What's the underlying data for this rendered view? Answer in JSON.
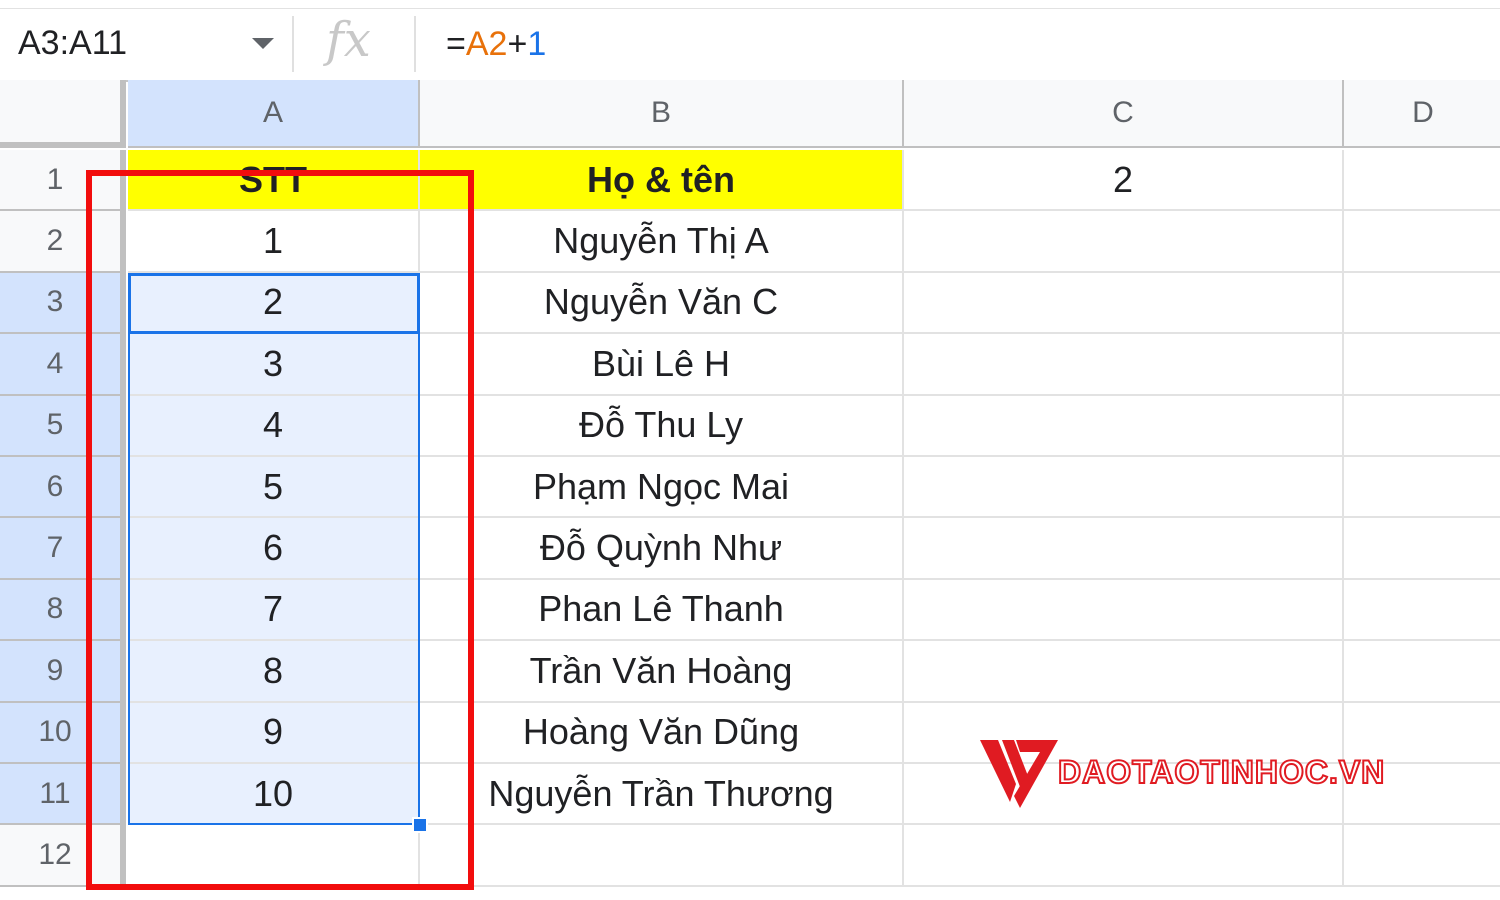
{
  "formula_bar": {
    "name_box": "A3:A11",
    "fx_label": "fx",
    "formula_prefix": "=",
    "formula_ref": "A2",
    "formula_op": "+",
    "formula_num": "1"
  },
  "columns": [
    {
      "label": "A",
      "selected": true
    },
    {
      "label": "B",
      "selected": false
    },
    {
      "label": "C",
      "selected": false
    },
    {
      "label": "D",
      "selected": false
    }
  ],
  "rows": [
    {
      "num": "1",
      "a": "STT",
      "b": "Họ & tên",
      "c": "2"
    },
    {
      "num": "2",
      "a": "1",
      "b": "Nguyễn Thị A",
      "c": ""
    },
    {
      "num": "3",
      "a": "2",
      "b": "Nguyễn Văn C",
      "c": ""
    },
    {
      "num": "4",
      "a": "3",
      "b": "Bùi Lê H",
      "c": ""
    },
    {
      "num": "5",
      "a": "4",
      "b": "Đỗ Thu Ly",
      "c": ""
    },
    {
      "num": "6",
      "a": "5",
      "b": "Phạm Ngọc Mai",
      "c": ""
    },
    {
      "num": "7",
      "a": "6",
      "b": "Đỗ Quỳnh Như",
      "c": ""
    },
    {
      "num": "8",
      "a": "7",
      "b": "Phan Lê Thanh",
      "c": ""
    },
    {
      "num": "9",
      "a": "8",
      "b": "Trần Văn Hoàng",
      "c": ""
    },
    {
      "num": "10",
      "a": "9",
      "b": "Hoàng Văn Dũng",
      "c": ""
    },
    {
      "num": "11",
      "a": "10",
      "b": "Nguyễn Trần Thương",
      "c": ""
    },
    {
      "num": "12",
      "a": "",
      "b": "",
      "c": ""
    }
  ],
  "header_fill_color": "#ffff00",
  "selection_color": "#1a73e8",
  "highlight_color": "#f20d0d",
  "logo": {
    "text": "DAOTAOTINHOC.VN",
    "color": "#e01b22"
  }
}
